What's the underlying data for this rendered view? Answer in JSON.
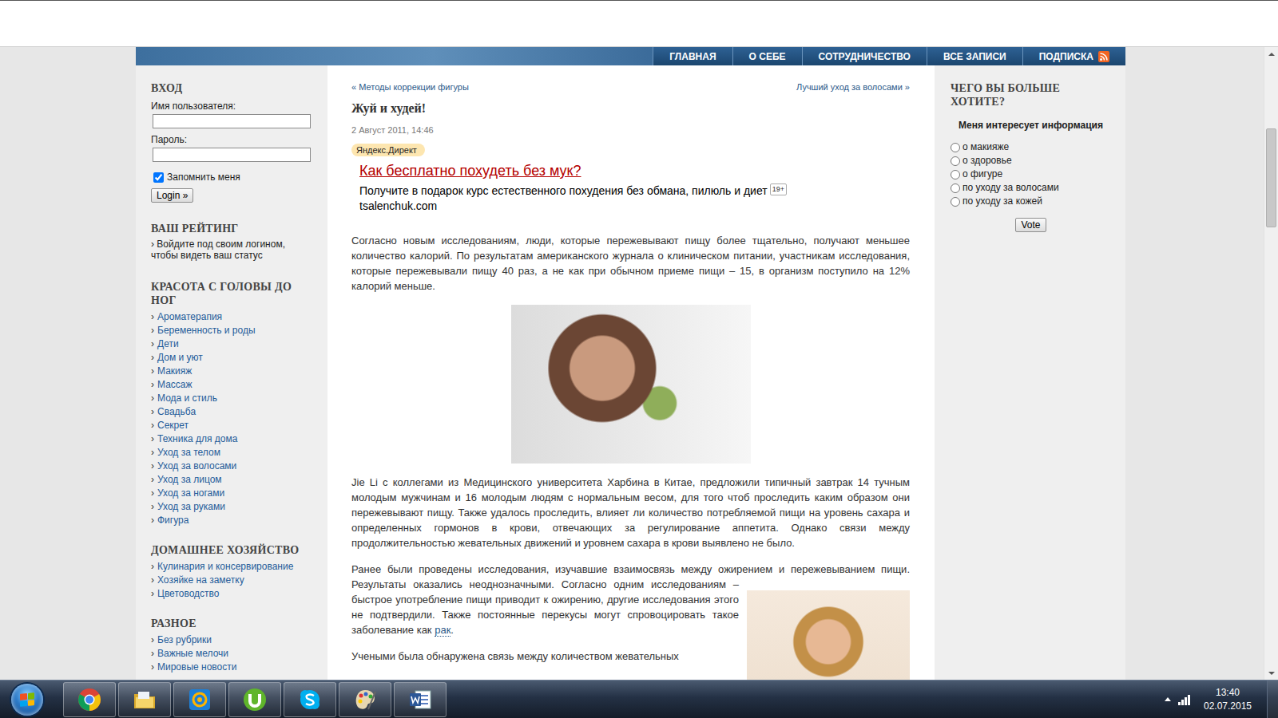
{
  "nav": [
    {
      "label": "ГЛАВНАЯ"
    },
    {
      "label": "О СЕБЕ"
    },
    {
      "label": "СОТРУДНИЧЕСТВО"
    },
    {
      "label": "ВСЕ ЗАПИСИ"
    },
    {
      "label": "ПОДПИСКА"
    }
  ],
  "login": {
    "title": "ВХОД",
    "username_label": "Имя пользователя:",
    "password_label": "Пароль:",
    "remember": {
      "label": "Запомнить меня",
      "checked": true
    },
    "button": "Login »"
  },
  "rating": {
    "title": "ВАШ РЕЙТИНГ",
    "text": "› Войдите под своим логином, чтобы видеть ваш статус"
  },
  "categories": [
    {
      "title": "КРАСОТА С ГОЛОВЫ ДО НОГ",
      "bullet": "›",
      "items": [
        "Ароматерапия",
        "Беременность и роды",
        "Дети",
        "Дом и уют",
        "Макияж",
        "Массаж",
        "Мода и стиль",
        "Свадьба",
        "Секрет",
        "Техника для дома",
        "Уход за телом",
        "Уход за волосами",
        "Уход за лицом",
        "Уход за ногами",
        "Уход за руками",
        "Фигура"
      ]
    },
    {
      "title": "ДОМАШНЕЕ ХОЗЯЙСТВО",
      "bullet": "›",
      "items": [
        "Кулинария и консервирование",
        "Хозяйке на заметку",
        "Цветоводство"
      ]
    },
    {
      "title": "РАЗНОЕ",
      "bullet": "›",
      "items": [
        "Без рубрики",
        "Важные мелочи",
        "Мировые новости"
      ]
    }
  ],
  "post_nav": {
    "prev": "« Методы коррекции фигуры",
    "next": "Лучший уход за волосами »"
  },
  "post": {
    "title": "Жуй и худей!",
    "date": "2 Август 2011, 14:46",
    "ad": {
      "badge": "Яндекс.Директ",
      "title": "Как бесплатно похудеть без мук?",
      "text": "Получите в подарок курс естественного похудения без обмана, пилюль и диет",
      "age": "19+",
      "url": "tsalenchuk.com"
    },
    "paragraphs": [
      {
        "kind": "text",
        "parts": [
          {
            "text": "Согласно новым исследованиям, люди, которые пережевывают пищу более  тщательно, получают меньшее количество калорий.  По результатам американского журнала о клиническом питании, участникам исследования, которые пережевывали пищу 40 раз, а не как при обычном приеме пищи – 15, в организм поступило на 12% калорий меньше.",
            "link": false
          }
        ]
      },
      {
        "kind": "image",
        "parts": []
      },
      {
        "kind": "text",
        "parts": [
          {
            "text": "Jie Li с коллегами из Медицинского университета Харбина в Китае, предложили типичный завтрак 14 тучным молодым мужчинам и 16 молодым людям с нормальным весом, для того чтоб проследить каким образом они пережевывают пищу. Также  удалось проследить, влияет ли количество потребляемой пищи на уровень сахара и определенных гормонов  в крови, отвечающих за регулирование аппетита.  Однако связи между продолжительностью жевательных движений  и уровнем сахара в крови  выявлено не было.",
            "link": false
          }
        ]
      },
      {
        "kind": "text-figure",
        "parts": [
          {
            "text": "Ранее были проведены исследования, изучавшие взаимосвязь между ожирением и пережевыванием пищи. Результаты оказались неоднозначными. Согласно одним исследованиям – быстрое употребление пищи приводит к ожирению, другие исследования этого не подтвердили. Также постоянные перекусы могут спровоцировать такое заболевание как ",
            "link": false
          },
          {
            "text": "рак",
            "link": true
          },
          {
            "text": ".",
            "link": false
          }
        ]
      },
      {
        "kind": "text",
        "parts": [
          {
            "text": "Учеными была обнаружена связь между количеством жевательных",
            "link": false
          }
        ]
      }
    ]
  },
  "poll": {
    "title": "ЧЕГО ВЫ БОЛЬШЕ ХОТИТЕ?",
    "question": "Меня интересует информация",
    "options": [
      {
        "label": "о макияже",
        "selected": false
      },
      {
        "label": "о здоровье",
        "selected": false
      },
      {
        "label": "о фигуре",
        "selected": false
      },
      {
        "label": "по уходу за волосами",
        "selected": false
      },
      {
        "label": "по уходу за кожей",
        "selected": false
      }
    ],
    "button": "Vote"
  },
  "scrollbar": {
    "offset": 0.112,
    "size": 0.164
  },
  "taskbar": {
    "apps": [
      {
        "kind": "chrome"
      },
      {
        "kind": "explorer"
      },
      {
        "kind": "mail"
      },
      {
        "kind": "utorrent"
      },
      {
        "kind": "skype"
      },
      {
        "kind": "paint"
      },
      {
        "kind": "word"
      }
    ]
  },
  "clock": {
    "time": "13:40",
    "date": "02.07.2015"
  }
}
